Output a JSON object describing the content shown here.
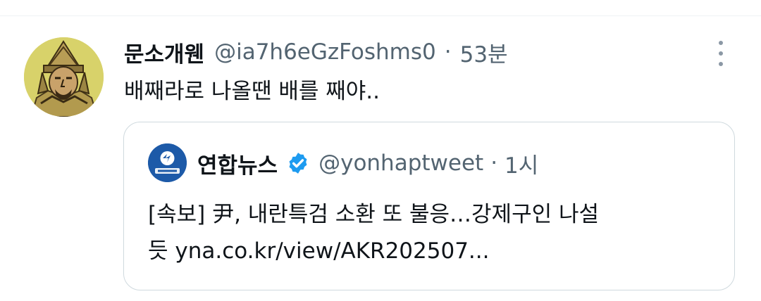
{
  "tweet": {
    "display_name": "문소개웬",
    "handle": "@ia7h6eGzFoshms0",
    "separator": "·",
    "time": "53분",
    "text": "배째라로 나올땐 배를 째야..",
    "avatar_icon": "armored-king-portrait-icon",
    "more_icon": "more-vertical-icon"
  },
  "quote": {
    "display_name": "연합뉴스",
    "handle": "@yonhaptweet",
    "separator": "·",
    "time": "1시",
    "verified_icon": "verified-badge-icon",
    "avatar_label": "연합뉴스",
    "text_line1": "[속보] 尹, 내란특검 소환 또 불응…강제구인 나설",
    "text_line2": "듯 yna.co.kr/view/AKR202507..."
  },
  "colors": {
    "text": "#0f1419",
    "secondary": "#536471",
    "border": "#cfd9de",
    "verified": "#1d9bf0",
    "yonhap_blue": "#1d5aa8"
  }
}
